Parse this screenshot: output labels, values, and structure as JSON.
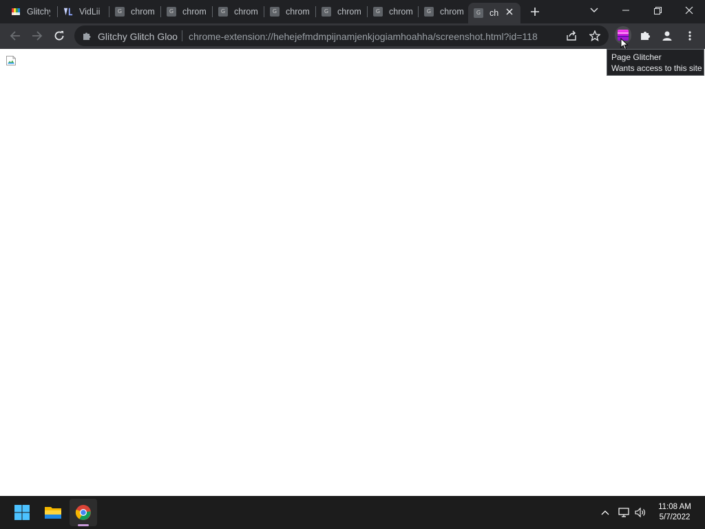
{
  "tabs": [
    {
      "label": "Glitchy",
      "favicon": "glitchy-favicon"
    },
    {
      "label": "VidLii",
      "favicon": "vidlii-logo"
    },
    {
      "label": "chrom",
      "favicon": "g-favicon",
      "favicon_letter": "G"
    },
    {
      "label": "chrom",
      "favicon": "g-favicon",
      "favicon_letter": "G"
    },
    {
      "label": "chrom",
      "favicon": "g-favicon",
      "favicon_letter": "G"
    },
    {
      "label": "chrom",
      "favicon": "g-favicon",
      "favicon_letter": "G"
    },
    {
      "label": "chrom",
      "favicon": "g-favicon",
      "favicon_letter": "G"
    },
    {
      "label": "chrom",
      "favicon": "g-favicon",
      "favicon_letter": "G"
    },
    {
      "label": "chrom",
      "favicon": "g-favicon",
      "favicon_letter": "G"
    },
    {
      "label": "ch",
      "favicon": "g-favicon",
      "favicon_letter": "G",
      "active": true
    }
  ],
  "omnibox": {
    "site_label": "Glitchy Glitch Gloo",
    "url": "chrome-extension://hehejefmdmpijnamjenkjogiamhoahha/screenshot.html?id=118"
  },
  "tooltip": {
    "title": "Page Glitcher",
    "subtitle": "Wants access to this site"
  },
  "taskbar": {
    "time": "11:08 AM",
    "date": "5/7/2022"
  },
  "colors": {
    "tabstrip_bg": "#202124",
    "toolbar_bg": "#35363a",
    "taskbar_bg": "#1c1c1c",
    "extension_accent": "#c01ad8"
  }
}
